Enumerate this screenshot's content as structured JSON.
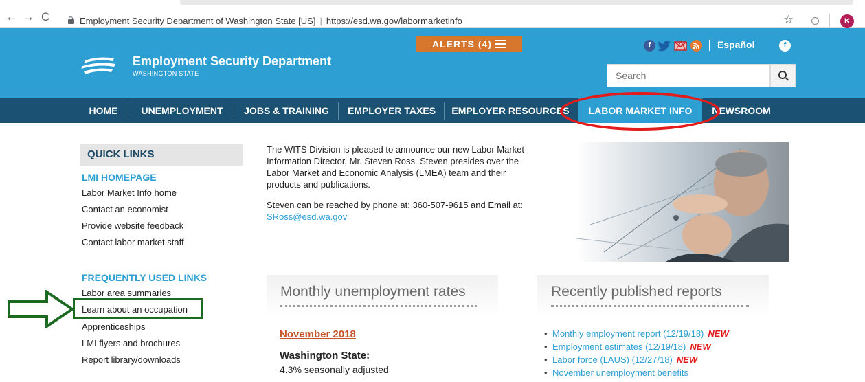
{
  "browser": {
    "site_identity": "Employment Security Department of Washington State [US]",
    "url": "https://esd.wa.gov/labormarketinfo",
    "profile_initial": "K"
  },
  "header": {
    "logo_title": "Employment Security Department",
    "logo_subtitle": "WASHINGTON STATE",
    "alerts_label": "ALERTS (4)",
    "language_link": "Español",
    "search_placeholder": "Search"
  },
  "nav": {
    "items": [
      "HOME",
      "UNEMPLOYMENT",
      "JOBS & TRAINING",
      "EMPLOYER TAXES",
      "EMPLOYER RESOURCES",
      "LABOR MARKET INFO",
      "NEWSROOM"
    ],
    "active": "LABOR MARKET INFO"
  },
  "sidebar": {
    "quick_links_title": "QUICK LINKS",
    "lmi_title": "LMI HOMEPAGE",
    "lmi_links": [
      "Labor Market Info home",
      "Contact an economist",
      "Provide website feedback",
      "Contact labor market staff"
    ],
    "frequent_title": "FREQUENTLY USED LINKS",
    "frequent_links": [
      "Labor area summaries",
      "Learn about an occupation",
      "Apprenticeships",
      "LMI flyers and brochures",
      "Report library/downloads"
    ]
  },
  "main": {
    "intro_p1": "The WITS Division is pleased to announce our new Labor Market Information Director, Mr. Steven Ross. Steven presides over the Labor Market and Economic Analysis (LMEA) team and their products and publications.",
    "intro_p2": "Steven can be reached by phone at: 360-507-9615 and Email at: ",
    "email": "SRoss@esd.wa.gov",
    "unemployment_title": "Monthly unemployment rates",
    "month_link": "November 2018",
    "region": "Washington State:",
    "rate_text": "4.3% seasonally adjusted",
    "reports_title": "Recently published reports",
    "reports": [
      {
        "label": "Monthly employment report (12/19/18)",
        "badge": "NEW"
      },
      {
        "label": "Employment estimates (12/19/18)",
        "badge": "NEW"
      },
      {
        "label": "Labor force (LAUS) (12/27/18)",
        "badge": "NEW"
      },
      {
        "label": "November unemployment benefits",
        "badge": ""
      }
    ]
  },
  "colors": {
    "header_blue": "#2e9fd3",
    "nav_navy": "#1b5172",
    "alert_orange": "#d7762d",
    "highlight_red": "#e31b1b",
    "highlight_green": "#1c6a21"
  }
}
